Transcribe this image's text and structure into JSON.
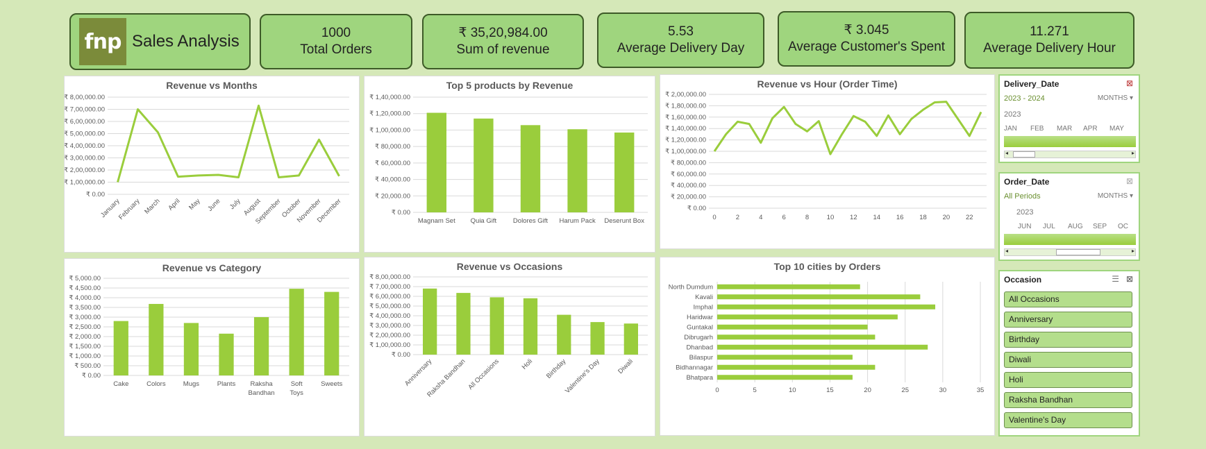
{
  "header": {
    "logo_text": "fnp",
    "title": "Sales Analysis"
  },
  "kpis": [
    {
      "value": "1000",
      "label": "Total Orders"
    },
    {
      "value": "₹ 35,20,984.00",
      "label": "Sum of revenue"
    },
    {
      "value": "5.53",
      "label": "Average Delivery Day"
    },
    {
      "value": "₹ 3.045",
      "label": "Average Customer's Spent"
    },
    {
      "value": "11.271",
      "label": "Average Delivery Hour"
    }
  ],
  "colors": {
    "accent": "#9acd3c",
    "card": "#9fd57e",
    "background": "#d5e8b8"
  },
  "chart_data": [
    {
      "id": "months",
      "type": "line",
      "title": "Revenue vs Months",
      "categories": [
        "January",
        "February",
        "March",
        "April",
        "May",
        "June",
        "July",
        "August",
        "September",
        "October",
        "November",
        "December"
      ],
      "values": [
        100000,
        700000,
        510000,
        145000,
        155000,
        160000,
        140000,
        730000,
        140000,
        155000,
        450000,
        150000
      ],
      "yticks": [
        "₹ 0.00",
        "₹ 1,00,000.00",
        "₹ 2,00,000.00",
        "₹ 3,00,000.00",
        "₹ 4,00,000.00",
        "₹ 5,00,000.00",
        "₹ 6,00,000.00",
        "₹ 7,00,000.00",
        "₹ 8,00,000.00"
      ],
      "ylim": [
        0,
        800000
      ]
    },
    {
      "id": "products",
      "type": "bar",
      "title": "Top 5 products by Revenue",
      "categories": [
        "Magnam Set",
        "Quia Gift",
        "Dolores Gift",
        "Harum Pack",
        "Deserunt Box"
      ],
      "values": [
        121000,
        114000,
        106000,
        101000,
        97000
      ],
      "yticks": [
        "₹ 0.00",
        "₹ 20,000.00",
        "₹ 40,000.00",
        "₹ 60,000.00",
        "₹ 80,000.00",
        "₹ 1,00,000.00",
        "₹ 1,20,000.00",
        "₹ 1,40,000.00"
      ],
      "ylim": [
        0,
        140000
      ]
    },
    {
      "id": "hour",
      "type": "line",
      "title": "Revenue vs Hour (Order Time)",
      "x": [
        0,
        1,
        2,
        3,
        4,
        5,
        6,
        7,
        8,
        9,
        10,
        11,
        12,
        13,
        14,
        15,
        16,
        17,
        18,
        19,
        20,
        21,
        22,
        23
      ],
      "values": [
        100000,
        130000,
        152000,
        148000,
        115000,
        158000,
        178000,
        148000,
        135000,
        153000,
        95000,
        130000,
        162000,
        152000,
        127000,
        163000,
        130000,
        157000,
        173000,
        186000,
        187000,
        157000,
        127000,
        169000
      ],
      "xticks": [
        "0",
        "2",
        "4",
        "6",
        "8",
        "10",
        "12",
        "14",
        "16",
        "18",
        "20",
        "22"
      ],
      "yticks": [
        "₹ 0.00",
        "₹ 20,000.00",
        "₹ 40,000.00",
        "₹ 60,000.00",
        "₹ 80,000.00",
        "₹ 1,00,000.00",
        "₹ 1,20,000.00",
        "₹ 1,40,000.00",
        "₹ 1,60,000.00",
        "₹ 1,80,000.00",
        "₹ 2,00,000.00"
      ],
      "ylim": [
        0,
        200000
      ]
    },
    {
      "id": "category",
      "type": "bar",
      "title": "Revenue vs Category",
      "categories": [
        "Cake",
        "Colors",
        "Mugs",
        "Plants",
        "Raksha Bandhan",
        "Soft Toys",
        "Sweets"
      ],
      "values": [
        2800,
        3680,
        2700,
        2150,
        3000,
        4460,
        4300
      ],
      "yticks": [
        "₹ 0.00",
        "₹ 500.00",
        "₹ 1,000.00",
        "₹ 1,500.00",
        "₹ 2,000.00",
        "₹ 2,500.00",
        "₹ 3,000.00",
        "₹ 3,500.00",
        "₹ 4,000.00",
        "₹ 4,500.00",
        "₹ 5,000.00"
      ],
      "ylim": [
        0,
        5000
      ]
    },
    {
      "id": "occasions",
      "type": "bar",
      "title": "Revenue vs Occasions",
      "categories": [
        "Anniversary",
        "Raksha Bandhan",
        "All Occasions",
        "Holi",
        "Birthday",
        "Valentine's Day",
        "Diwali"
      ],
      "values": [
        680000,
        635000,
        590000,
        580000,
        410000,
        335000,
        320000
      ],
      "yticks": [
        "₹ 0.00",
        "₹ 1,00,000.00",
        "₹ 2,00,000.00",
        "₹ 3,00,000.00",
        "₹ 4,00,000.00",
        "₹ 5,00,000.00",
        "₹ 6,00,000.00",
        "₹ 7,00,000.00",
        "₹ 8,00,000.00"
      ],
      "ylim": [
        0,
        800000
      ]
    },
    {
      "id": "cities",
      "type": "bar",
      "orientation": "horizontal",
      "title": "Top 10 cities by  Orders",
      "categories": [
        "North Dumdum",
        "Kavali",
        "Imphal",
        "Haridwar",
        "Guntakal",
        "Dibrugarh",
        "Dhanbad",
        "Bilaspur",
        "Bidhannagar",
        "Bhatpara"
      ],
      "values": [
        19,
        27,
        29,
        24,
        20,
        21,
        28,
        18,
        21,
        18
      ],
      "xticks": [
        "0",
        "5",
        "10",
        "15",
        "20",
        "25",
        "30",
        "35"
      ],
      "xlim": [
        0,
        35
      ]
    }
  ],
  "slicers": {
    "delivery": {
      "title": "Delivery_Date",
      "range": "2023 - 2024",
      "unit": "MONTHS",
      "year": "2023",
      "months": [
        "JAN",
        "FEB",
        "MAR",
        "APR",
        "MAY"
      ]
    },
    "order": {
      "title": "Order_Date",
      "range": "All Periods",
      "unit": "MONTHS",
      "year": "2023",
      "months": [
        "JUN",
        "JUL",
        "AUG",
        "SEP",
        "OC"
      ]
    },
    "occasion": {
      "title": "Occasion",
      "items": [
        "All Occasions",
        "Anniversary",
        "Birthday",
        "Diwali",
        "Holi",
        "Raksha Bandhan",
        "Valentine's Day"
      ]
    }
  }
}
